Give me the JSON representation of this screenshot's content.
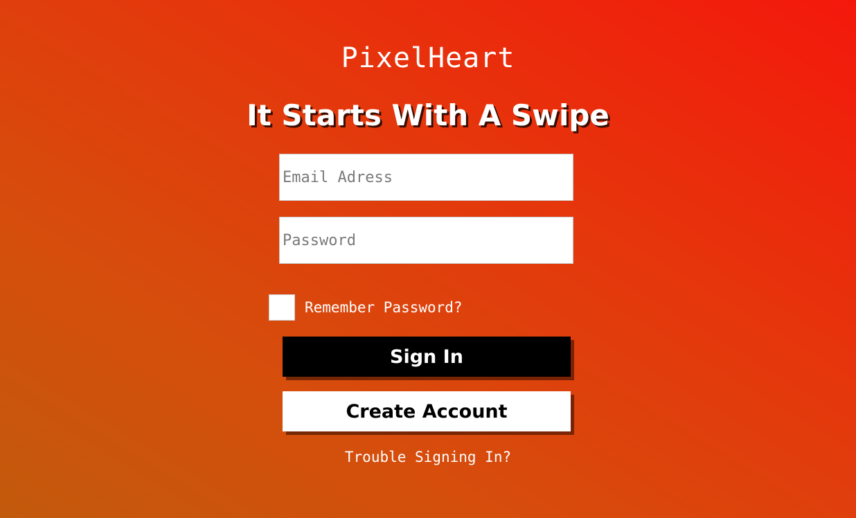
{
  "app": {
    "title": "PixelHeart",
    "tagline": "It Starts With A Swipe"
  },
  "form": {
    "email_placeholder": "Email Adress",
    "email_value": "",
    "password_placeholder": "Password",
    "password_value": "",
    "remember_label": "Remember Password?",
    "remember_checked": false,
    "signin_label": "Sign In",
    "create_label": "Create Account",
    "trouble_label": "Trouble Signing In?"
  },
  "colors": {
    "background_start": "#c25a0c",
    "background_end": "#f4180c",
    "signin_button": "#000000",
    "create_button": "#ffffff"
  }
}
